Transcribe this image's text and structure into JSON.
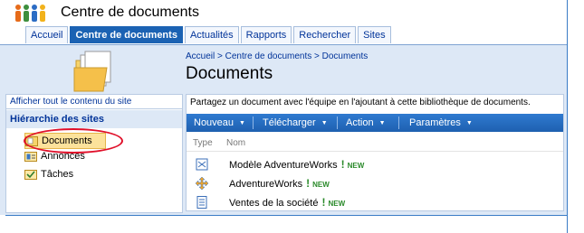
{
  "site": {
    "title": "Centre de documents",
    "icon": "people-icon"
  },
  "tabs": [
    {
      "label": "Accueil",
      "selected": false
    },
    {
      "label": "Centre de documents",
      "selected": true
    },
    {
      "label": "Actualités",
      "selected": false
    },
    {
      "label": "Rapports",
      "selected": false
    },
    {
      "label": "Rechercher",
      "selected": false
    },
    {
      "label": "Sites",
      "selected": false
    }
  ],
  "breadcrumb": "Accueil > Centre de documents > Documents",
  "page_title": "Documents",
  "quick_launch": {
    "view_all": "Afficher tout le contenu du site",
    "section": "Hiérarchie des sites",
    "items": [
      {
        "label": "Documents",
        "icon": "document-library-icon",
        "current": true
      },
      {
        "label": "Annonces",
        "icon": "announcements-icon",
        "current": false
      },
      {
        "label": "Tâches",
        "icon": "tasks-icon",
        "current": false
      }
    ]
  },
  "main": {
    "description": "Partagez un document avec l'équipe en l'ajoutant à cette bibliothèque de documents.",
    "toolbar": {
      "new": "Nouveau",
      "upload": "Télécharger",
      "action": "Action",
      "settings": "Paramètres"
    },
    "columns": {
      "type": "Type",
      "name": "Nom"
    },
    "rows": [
      {
        "name": "Modèle AdventureWorks",
        "icon": "model-icon",
        "bang": "!",
        "new": "NEW"
      },
      {
        "name": "AdventureWorks",
        "icon": "data-source-icon",
        "bang": "!",
        "new": "NEW"
      },
      {
        "name": "Ventes de la société",
        "icon": "report-icon",
        "bang": "!",
        "new": "NEW"
      }
    ]
  },
  "colors": {
    "accent": "#1b62b3",
    "panel": "#dde8f6",
    "link": "#003399",
    "new_badge": "#2a8a2a",
    "annotation": "#e0102a"
  }
}
